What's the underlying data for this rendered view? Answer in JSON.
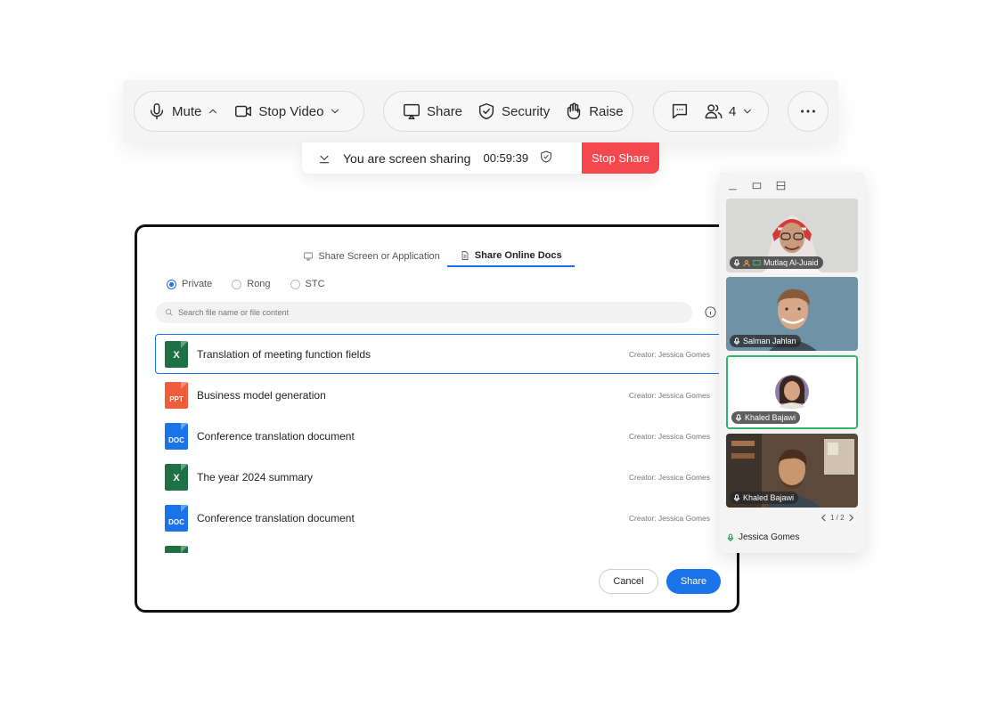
{
  "toolbar": {
    "mute_label": "Mute",
    "stop_video_label": "Stop Video",
    "share_label": "Share",
    "security_label": "Security",
    "raise_label": "Raise",
    "participants_count": "4"
  },
  "share_bar": {
    "message": "You are screen sharing",
    "timer": "00:59:39",
    "stop_label": "Stop Share",
    "stop_color": "#f5484e"
  },
  "dialog": {
    "tabs": [
      {
        "label": "Share Screen or Application",
        "icon": "monitor-icon"
      },
      {
        "label": "Share Online Docs",
        "icon": "document-icon"
      }
    ],
    "scopes": [
      "Private",
      "Rong",
      "STC"
    ],
    "selected_scope": "Private",
    "search_placeholder": "Search file name or file content",
    "files": [
      {
        "name": "Translation of meeting function fields",
        "type": "X",
        "color": "#1e7145",
        "creator": "Creator: Jessica Gomes"
      },
      {
        "name": "Business model generation",
        "type": "PPT",
        "color": "#f25c3b",
        "creator": "Creator: Jessica Gomes"
      },
      {
        "name": "Conference translation document",
        "type": "DOC",
        "color": "#1a73e8",
        "creator": "Creator: Jessica Gomes"
      },
      {
        "name": "The year 2024 summary",
        "type": "X",
        "color": "#1e7145",
        "creator": "Creator: Jessica Gomes"
      },
      {
        "name": "Conference translation document",
        "type": "DOC",
        "color": "#1a73e8",
        "creator": "Creator: Jessica Gomes"
      }
    ],
    "cancel_label": "Cancel",
    "share_label": "Share",
    "accent_color": "#1a73e8"
  },
  "panel": {
    "participants": [
      {
        "name": "Mutlaq Al-Juaid"
      },
      {
        "name": "Salman Jahlan"
      },
      {
        "name": "Khaled Bajawi"
      },
      {
        "name": "Khaled Bajawi"
      }
    ],
    "page_indicator": "1 / 2",
    "self_name": "Jessica Gomes",
    "active_speaker_color": "#34b36b"
  }
}
